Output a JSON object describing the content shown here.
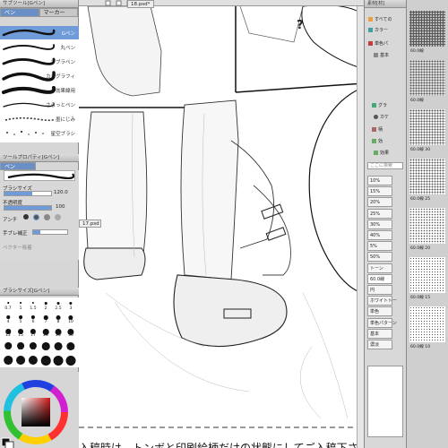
{
  "left_panel": {
    "subtool_title": "サブツール[Gペン]",
    "tabs": [
      "ペン",
      "マーカー"
    ],
    "brushes": [
      {
        "label": "Gペン",
        "selected": true
      },
      {
        "label": "丸ペン",
        "selected": false
      },
      {
        "label": "カブラペン",
        "selected": false
      },
      {
        "label": "カリグラフィ",
        "selected": false
      },
      {
        "label": "効果線用",
        "selected": false
      },
      {
        "label": "さらっとペン",
        "selected": false
      },
      {
        "label": "墨にじみ",
        "selected": false
      },
      {
        "label": "星空ブラシ",
        "selected": false
      }
    ],
    "tool_property_title": "ツールプロパティ[Gペン]",
    "tool_property_tab": "ペン",
    "brush_size_label": "ブラシサイズ",
    "brush_size_value": "120.0",
    "opacity_label": "不透明度",
    "opacity_value": "100",
    "antialias_label": "アンチ",
    "stabilization_label": "手ブレ補正",
    "vector_snap_label": "ベクター吸着",
    "brush_size_panel_title": "ブラシサイズ[Gペン]",
    "size_values": [
      "0.7",
      "1",
      "1.5",
      "2",
      "2.5",
      "3",
      "4",
      "5",
      "6",
      "7",
      "8",
      "10",
      "12",
      "15",
      "17",
      "20",
      "25",
      "30",
      "40",
      "50",
      "60",
      "70",
      "80",
      "100",
      "120",
      "150",
      "170",
      "200",
      "250",
      "300"
    ]
  },
  "file_tabs": [
    "17.psd",
    "18.psd*"
  ],
  "canvas": {
    "bubble_text": "?",
    "caption": "入稿時は、トンボと印刷絵柄だけの状態にしてご入稿下さい。"
  },
  "material_panel": {
    "title": "素材[材]",
    "tree": [
      "すべての",
      "カラー",
      "単色パ",
      "基本",
      "グラ",
      "カケ",
      "柄",
      "効",
      "効果"
    ],
    "search_placeholder": "ここに検索",
    "tags": [
      "10%",
      "15%",
      "20%",
      "25%",
      "30%",
      "40%",
      "5%",
      "50%",
      "トーン",
      "60.0線",
      "円",
      "ホワイトトー",
      "単色",
      "単色パターン",
      "基本",
      "濃淡"
    ],
    "selected_tag": "60.0線"
  },
  "tone_panel": {
    "labels": [
      "60.0線",
      "60.0線",
      "60.0線 30",
      "60.0線 25",
      "60.0線 20",
      "60.0線 15",
      "60.0線 10"
    ]
  },
  "colors": {
    "selection": "#6f9bd8",
    "panel_bg": "#d6d6d6",
    "title_bar": "#bdbdbd"
  }
}
